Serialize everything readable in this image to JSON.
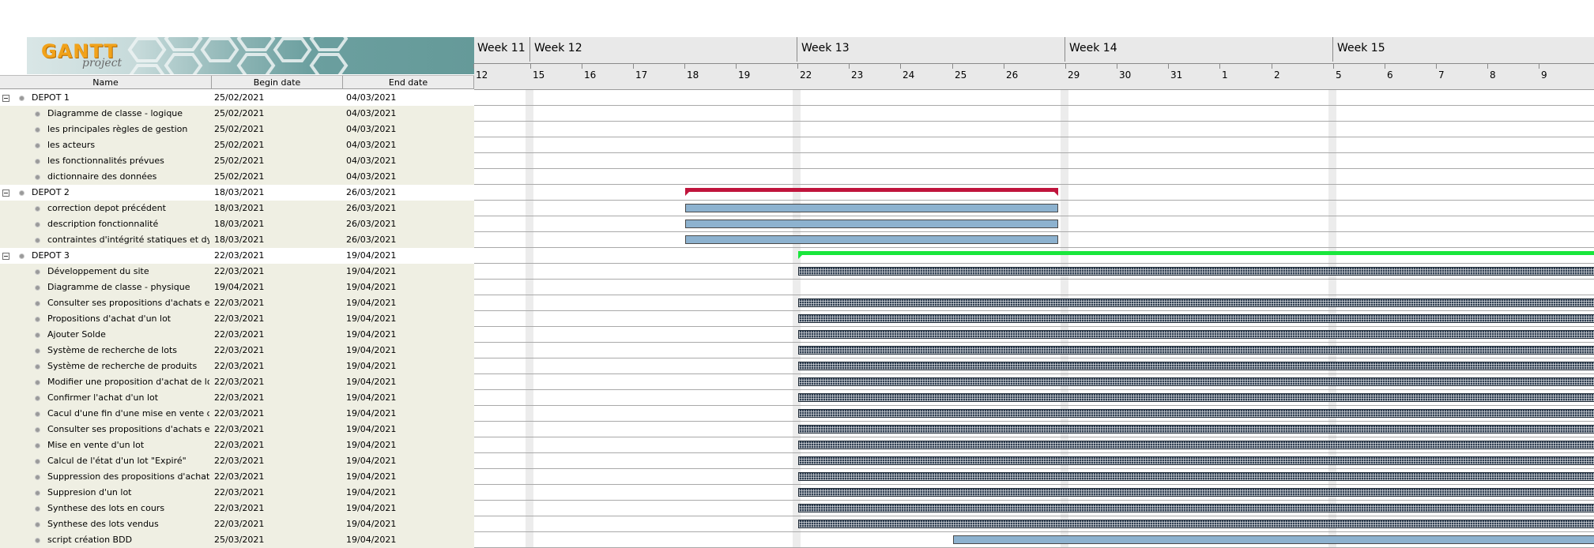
{
  "logo": {
    "word1": "GANTT",
    "word2": "project"
  },
  "table": {
    "columns": {
      "name": "Name",
      "begin": "Begin date",
      "end": "End date"
    },
    "rows": [
      {
        "name": "DEPOT 1",
        "begin": "25/02/2021",
        "end": "04/03/2021",
        "group": true
      },
      {
        "name": "Diagramme de classe - logique",
        "begin": "25/02/2021",
        "end": "04/03/2021"
      },
      {
        "name": "les principales règles de gestion",
        "begin": "25/02/2021",
        "end": "04/03/2021"
      },
      {
        "name": "les acteurs",
        "begin": "25/02/2021",
        "end": "04/03/2021"
      },
      {
        "name": "les fonctionnalités prévues",
        "begin": "25/02/2021",
        "end": "04/03/2021"
      },
      {
        "name": "dictionnaire des données",
        "begin": "25/02/2021",
        "end": "04/03/2021"
      },
      {
        "name": "DEPOT 2",
        "begin": "18/03/2021",
        "end": "26/03/2021",
        "group": true
      },
      {
        "name": "correction depot précédent",
        "begin": "18/03/2021",
        "end": "26/03/2021"
      },
      {
        "name": "description fonctionnalité",
        "begin": "18/03/2021",
        "end": "26/03/2021"
      },
      {
        "name": "contraintes d'intégrité statiques et dy...",
        "begin": "18/03/2021",
        "end": "26/03/2021"
      },
      {
        "name": "DEPOT 3",
        "begin": "22/03/2021",
        "end": "19/04/2021",
        "group": true
      },
      {
        "name": "Développement du site",
        "begin": "22/03/2021",
        "end": "19/04/2021"
      },
      {
        "name": "Diagramme de classe - physique",
        "begin": "19/04/2021",
        "end": "19/04/2021"
      },
      {
        "name": "Consulter ses propositions d'achats et...",
        "begin": "22/03/2021",
        "end": "19/04/2021"
      },
      {
        "name": "Propositions d'achat d'un lot",
        "begin": "22/03/2021",
        "end": "19/04/2021"
      },
      {
        "name": "Ajouter Solde",
        "begin": "22/03/2021",
        "end": "19/04/2021"
      },
      {
        "name": "Système de recherche de lots",
        "begin": "22/03/2021",
        "end": "19/04/2021"
      },
      {
        "name": "Système de recherche de produits",
        "begin": "22/03/2021",
        "end": "19/04/2021"
      },
      {
        "name": "Modifier une proposition d'achat de lot",
        "begin": "22/03/2021",
        "end": "19/04/2021"
      },
      {
        "name": "Confirmer l'achat d'un lot",
        "begin": "22/03/2021",
        "end": "19/04/2021"
      },
      {
        "name": "Cacul d'une fin d'une mise en vente d...",
        "begin": "22/03/2021",
        "end": "19/04/2021"
      },
      {
        "name": "Consulter ses propositions d'achats et...",
        "begin": "22/03/2021",
        "end": "19/04/2021"
      },
      {
        "name": "Mise en vente d'un lot",
        "begin": "22/03/2021",
        "end": "19/04/2021"
      },
      {
        "name": "Calcul de l'état d'un lot \"Expiré\"",
        "begin": "22/03/2021",
        "end": "19/04/2021"
      },
      {
        "name": "Suppression des propositions d'achat...",
        "begin": "22/03/2021",
        "end": "19/04/2021"
      },
      {
        "name": "Suppresion d'un lot",
        "begin": "22/03/2021",
        "end": "19/04/2021"
      },
      {
        "name": "Synthese des lots en cours",
        "begin": "22/03/2021",
        "end": "19/04/2021"
      },
      {
        "name": "Synthese des lots vendus",
        "begin": "22/03/2021",
        "end": "19/04/2021"
      },
      {
        "name": "script création BDD",
        "begin": "25/03/2021",
        "end": "19/04/2021"
      }
    ]
  },
  "timeline": {
    "weeks": [
      "Week 11",
      "Week 12",
      "Week 13",
      "Week 14",
      "Week 15"
    ],
    "days": [
      "12",
      "15",
      "16",
      "17",
      "18",
      "19",
      "22",
      "23",
      "24",
      "25",
      "26",
      "29",
      "30",
      "31",
      "1",
      "2",
      "5",
      "6",
      "7",
      "8",
      "9"
    ]
  },
  "bars": [
    {
      "row": 6,
      "start": "18/03/2021",
      "end": "26/03/2021",
      "style": "summary",
      "color": "#c0143c"
    },
    {
      "row": 7,
      "start": "18/03/2021",
      "end": "26/03/2021",
      "style": "plain"
    },
    {
      "row": 8,
      "start": "18/03/2021",
      "end": "26/03/2021",
      "style": "plain"
    },
    {
      "row": 9,
      "start": "18/03/2021",
      "end": "26/03/2021",
      "style": "plain"
    },
    {
      "row": 10,
      "start": "22/03/2021",
      "end": "19/04/2021",
      "style": "summary",
      "color": "#19e63c"
    },
    {
      "row": 11,
      "start": "22/03/2021",
      "end": "19/04/2021",
      "style": "hatch"
    },
    {
      "row": 13,
      "start": "22/03/2021",
      "end": "19/04/2021",
      "style": "hatch"
    },
    {
      "row": 14,
      "start": "22/03/2021",
      "end": "19/04/2021",
      "style": "hatch"
    },
    {
      "row": 15,
      "start": "22/03/2021",
      "end": "19/04/2021",
      "style": "hatch"
    },
    {
      "row": 16,
      "start": "22/03/2021",
      "end": "19/04/2021",
      "style": "hatch"
    },
    {
      "row": 17,
      "start": "22/03/2021",
      "end": "19/04/2021",
      "style": "hatch"
    },
    {
      "row": 18,
      "start": "22/03/2021",
      "end": "19/04/2021",
      "style": "hatch"
    },
    {
      "row": 19,
      "start": "22/03/2021",
      "end": "19/04/2021",
      "style": "hatch"
    },
    {
      "row": 20,
      "start": "22/03/2021",
      "end": "19/04/2021",
      "style": "hatch"
    },
    {
      "row": 21,
      "start": "22/03/2021",
      "end": "19/04/2021",
      "style": "hatch"
    },
    {
      "row": 22,
      "start": "22/03/2021",
      "end": "19/04/2021",
      "style": "hatch"
    },
    {
      "row": 23,
      "start": "22/03/2021",
      "end": "19/04/2021",
      "style": "hatch"
    },
    {
      "row": 24,
      "start": "22/03/2021",
      "end": "19/04/2021",
      "style": "hatch"
    },
    {
      "row": 25,
      "start": "22/03/2021",
      "end": "19/04/2021",
      "style": "hatch"
    },
    {
      "row": 26,
      "start": "22/03/2021",
      "end": "19/04/2021",
      "style": "hatch"
    },
    {
      "row": 27,
      "start": "22/03/2021",
      "end": "19/04/2021",
      "style": "hatch"
    },
    {
      "row": 28,
      "start": "25/03/2021",
      "end": "19/04/2021",
      "style": "plain"
    }
  ],
  "colors": {
    "plain_bar": "#8db2cf",
    "hatch_bar": "#2f3f52",
    "row_alt": "#efefe3",
    "header": "#e9e9e9"
  }
}
